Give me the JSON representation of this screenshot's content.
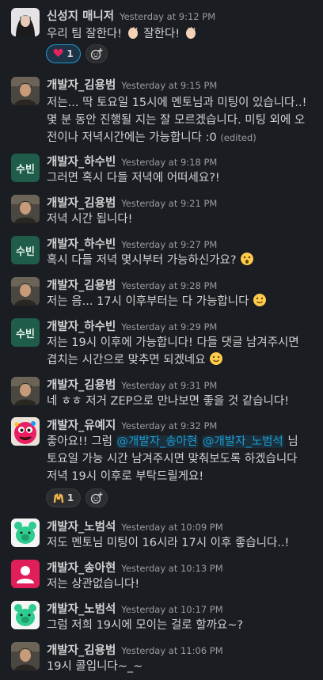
{
  "messages": [
    {
      "name": "신성지 매니저",
      "time": "Yesterday at 9:12 PM",
      "lines": [
        "우리 팀 잘한다!",
        "잘한다!"
      ]
    },
    {
      "name": "개발자_김용범",
      "time": "Yesterday at 9:15 PM",
      "lines": [
        "저는... 딱 토요일 15시에 멘토님과 미팅이 있습니다..!",
        "몇 분 동안 진행될 지는 잘 모르겠습니다. 미팅 외에 오",
        "전이나 저녁시간에는 가능합니다 :0"
      ],
      "edited": "(edited)"
    },
    {
      "name": "개발자_하수빈",
      "time": "Yesterday at 9:18 PM",
      "lines": [
        "그러면 혹시 다들 저녁에 어떠세요?!"
      ]
    },
    {
      "name": "개발자_김용범",
      "time": "Yesterday at 9:21 PM",
      "lines": [
        "저녁 시간 됩니다!"
      ]
    },
    {
      "name": "개발자_하수빈",
      "time": "Yesterday at 9:27 PM",
      "lines": [
        "혹시 다들 저녁 몇시부터 가능하신가요?"
      ]
    },
    {
      "name": "개발자_김용범",
      "time": "Yesterday at 9:28 PM",
      "lines": [
        "저는 음... 17시 이후부터는 다 가능합니다"
      ]
    },
    {
      "name": "개발자_하수빈",
      "time": "Yesterday at 9:29 PM",
      "lines": [
        "저는 19시 이후에 가능합니다! 다들 댓글 남겨주시면",
        "겹치는 시간으로 맞추면 되겠네요"
      ]
    },
    {
      "name": "개발자_김용범",
      "time": "Yesterday at 9:31 PM",
      "lines": [
        "네 ㅎㅎ 저거 ZEP으로 만나보면 좋을 것 같습니다!"
      ]
    },
    {
      "name": "개발자_유예지",
      "time": "Yesterday at 9:32 PM",
      "lines": [
        "좋아요!! 그럼",
        "@개발자_송아현",
        "@개발자_노범석",
        "님",
        "토요일 가능 시간 남겨주시면 맞춰보도록 하겠습니다",
        "저녁 19시 이후로 부탁드릴게요!"
      ]
    },
    {
      "name": "개발자_노범석",
      "time": "Yesterday at 10:09 PM",
      "lines": [
        "저도 멘토님 미팅이 16시라 17시 이후 좋습니다..!"
      ]
    },
    {
      "name": "개발자_송아현",
      "time": "Yesterday at 10:13 PM",
      "lines": [
        "저는 상관없습니다!"
      ]
    },
    {
      "name": "개발자_노범석",
      "time": "Yesterday at 10:17 PM",
      "lines": [
        "그럼 저희 19시에 모이는 걸로 할까요~?"
      ]
    },
    {
      "name": "개발자_김용범",
      "time": "Yesterday at 11:06 PM",
      "lines": [
        "19시 콜입니다~_~"
      ]
    }
  ],
  "reactions": {
    "heart": {
      "emoji": "❤️",
      "count": "1"
    },
    "raised_hands": {
      "emoji": "🙌",
      "count": "1"
    }
  },
  "avatars": {
    "soobin": "수빈"
  },
  "colors": {
    "background": "#1a1d21",
    "mention": "#1d9bd1",
    "text": "#d1d2d3",
    "muted": "#9b9c9e"
  }
}
